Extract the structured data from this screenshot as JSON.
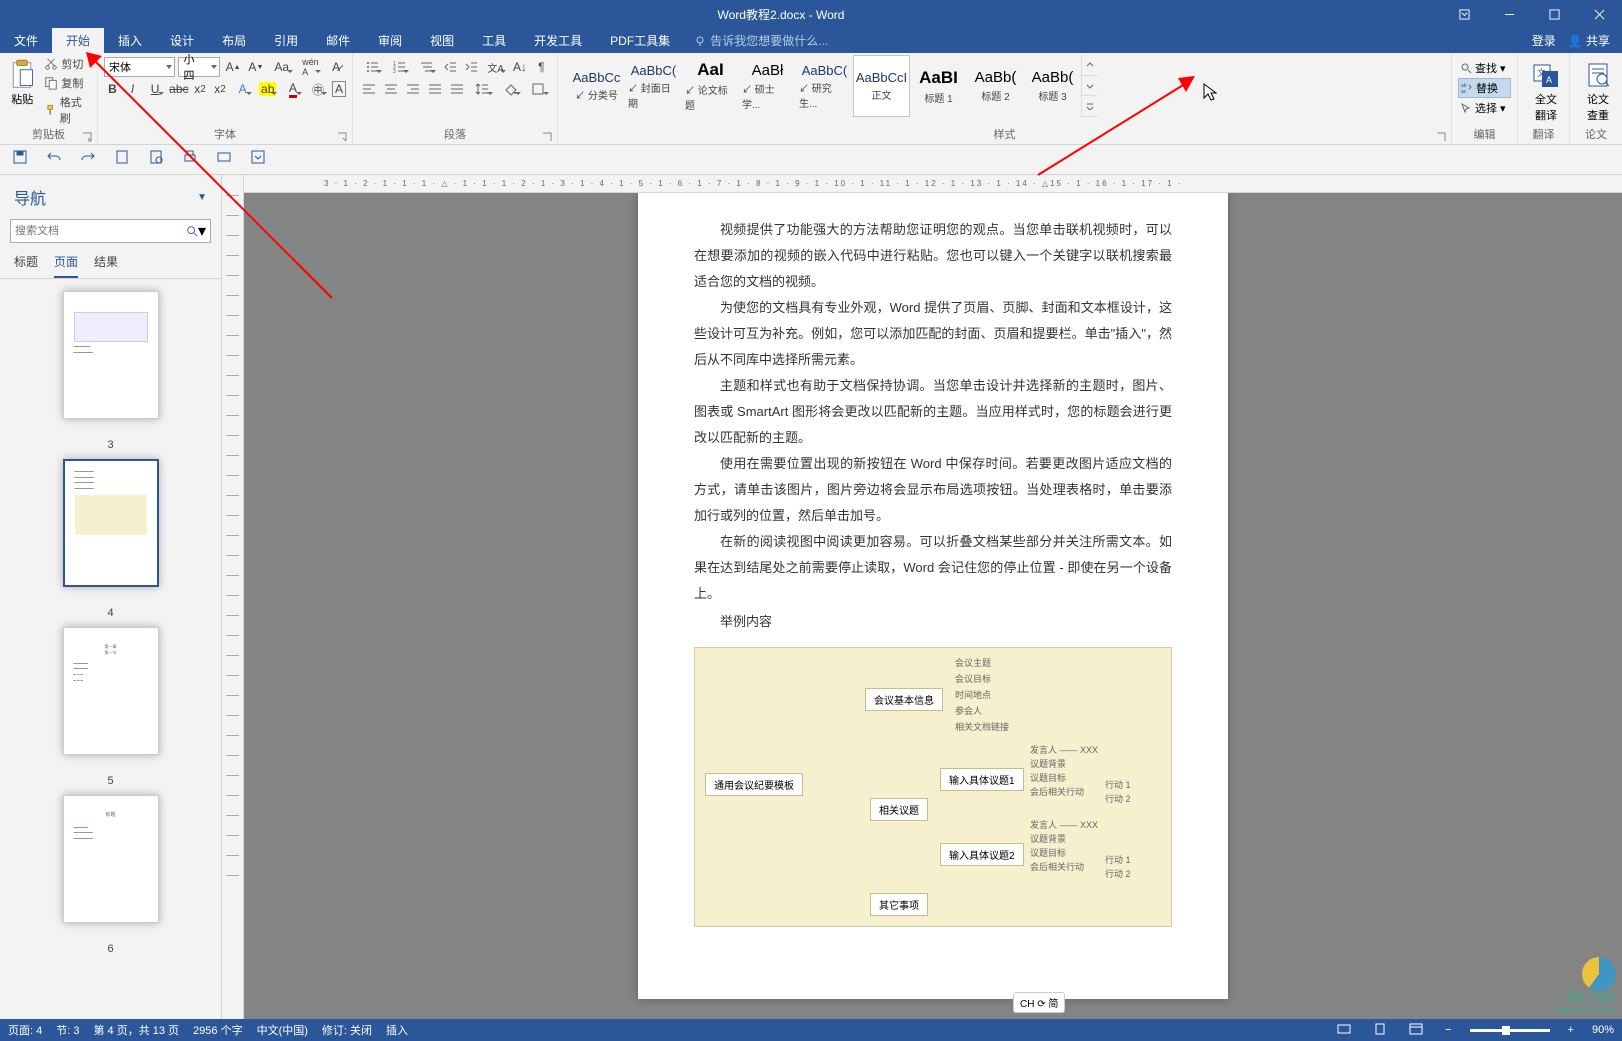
{
  "titlebar": {
    "title": "Word教程2.docx - Word"
  },
  "menubar": {
    "tabs": [
      "文件",
      "开始",
      "插入",
      "设计",
      "布局",
      "引用",
      "邮件",
      "审阅",
      "视图",
      "工具",
      "开发工具",
      "PDF工具集"
    ],
    "active_index": 1,
    "tellme_placeholder": "告诉我您想要做什么...",
    "login": "登录",
    "share": "共享"
  },
  "ribbon": {
    "clipboard": {
      "paste": "粘贴",
      "cut": "剪切",
      "copy": "复制",
      "format_painter": "格式刷",
      "group_label": "剪贴板"
    },
    "font": {
      "name": "宋体",
      "size": "小四",
      "group_label": "字体"
    },
    "paragraph": {
      "group_label": "段落"
    },
    "styles": {
      "items": [
        {
          "preview": "AaBbCc",
          "name": "分类号",
          "link": true
        },
        {
          "preview": "AaBbC(",
          "name": "封面日期",
          "link": true
        },
        {
          "preview": "AaI",
          "name": "论文标题",
          "link": true,
          "big": true
        },
        {
          "preview": "AaBł",
          "name": "硕士学...",
          "link": true,
          "med": true
        },
        {
          "preview": "AaBbC(",
          "name": "研究生...",
          "link": true
        },
        {
          "preview": "AaBbCcI",
          "name": "正文",
          "link": false,
          "selected": true
        },
        {
          "preview": "AaBI",
          "name": "标题 1",
          "link": false,
          "big": true
        },
        {
          "preview": "AaBb(",
          "name": "标题 2",
          "link": false,
          "med": true
        },
        {
          "preview": "AaBb(",
          "name": "标题 3",
          "link": false,
          "med": true
        }
      ],
      "group_label": "样式"
    },
    "editing": {
      "find": "查找",
      "replace": "替换",
      "select": "选择",
      "group_label": "编辑"
    },
    "translate": {
      "label": "全文\n翻译",
      "group_label": "翻译"
    },
    "check": {
      "label": "论文\n查重",
      "group_label": "论文"
    }
  },
  "navpane": {
    "title": "导航",
    "search_placeholder": "搜索文档",
    "tabs": [
      "标题",
      "页面",
      "结果"
    ],
    "active_tab": 1,
    "thumbs": [
      3,
      4,
      5,
      6
    ],
    "selected": 4
  },
  "document": {
    "p1": "视频提供了功能强大的方法帮助您证明您的观点。当您单击联机视频时，可以在想要添加的视频的嵌入代码中进行粘贴。您也可以键入一个关键字以联机搜索最适合您的文档的视频。",
    "p2": "为使您的文档具有专业外观，Word 提供了页眉、页脚、封面和文本框设计，这些设计可互为补充。例如，您可以添加匹配的封面、页眉和提要栏。单击\"插入\"，然后从不同库中选择所需元素。",
    "p3": "主题和样式也有助于文档保持协调。当您单击设计并选择新的主题时，图片、图表或 SmartArt 图形将会更改以匹配新的主题。当应用样式时，您的标题会进行更改以匹配新的主题。",
    "p4": "使用在需要位置出现的新按钮在 Word 中保存时间。若要更改图片适应文档的方式，请单击该图片，图片旁边将会显示布局选项按钮。当处理表格时，单击要添加行或列的位置，然后单击加号。",
    "p5": "在新的阅读视图中阅读更加容易。可以折叠文档某些部分并关注所需文本。如果在达到结尾处之前需要停止读取，Word 会记住您的停止位置 - 即使在另一个设备上。",
    "example_label": "举例内容",
    "mindmap": {
      "root": "通用会议纪要模板",
      "n1": "会议基本信息",
      "n1_leaves": [
        "会议主题",
        "会议目标",
        "时间地点",
        "参会人",
        "相关文档链接"
      ],
      "n2": "相关议题",
      "n2a": "输入具体议题1",
      "n2a_leaves": [
        "发言人 —— XXX",
        "议题背景",
        "议题目标",
        "会后相关行动"
      ],
      "n2a_actions": [
        "行动 1",
        "行动 2"
      ],
      "n2b": "输入具体议题2",
      "n2b_leaves": [
        "发言人 —— XXX",
        "议题背景",
        "议题目标",
        "会后相关行动"
      ],
      "n2b_actions": [
        "行动 1",
        "行动 2"
      ],
      "n3": "其它事项"
    },
    "ime_badge": "CH ⟳ 简"
  },
  "statusbar": {
    "page": "页面: 4",
    "section": "节: 3",
    "page_of": "第 4 页，共 13 页",
    "words": "2956 个字",
    "lang": "中文(中国)",
    "track": "修订: 关闭",
    "insert": "插入",
    "zoom": "90%"
  },
  "watermark": {
    "l1": "极光下载站",
    "l2": "www.xz7.com"
  }
}
